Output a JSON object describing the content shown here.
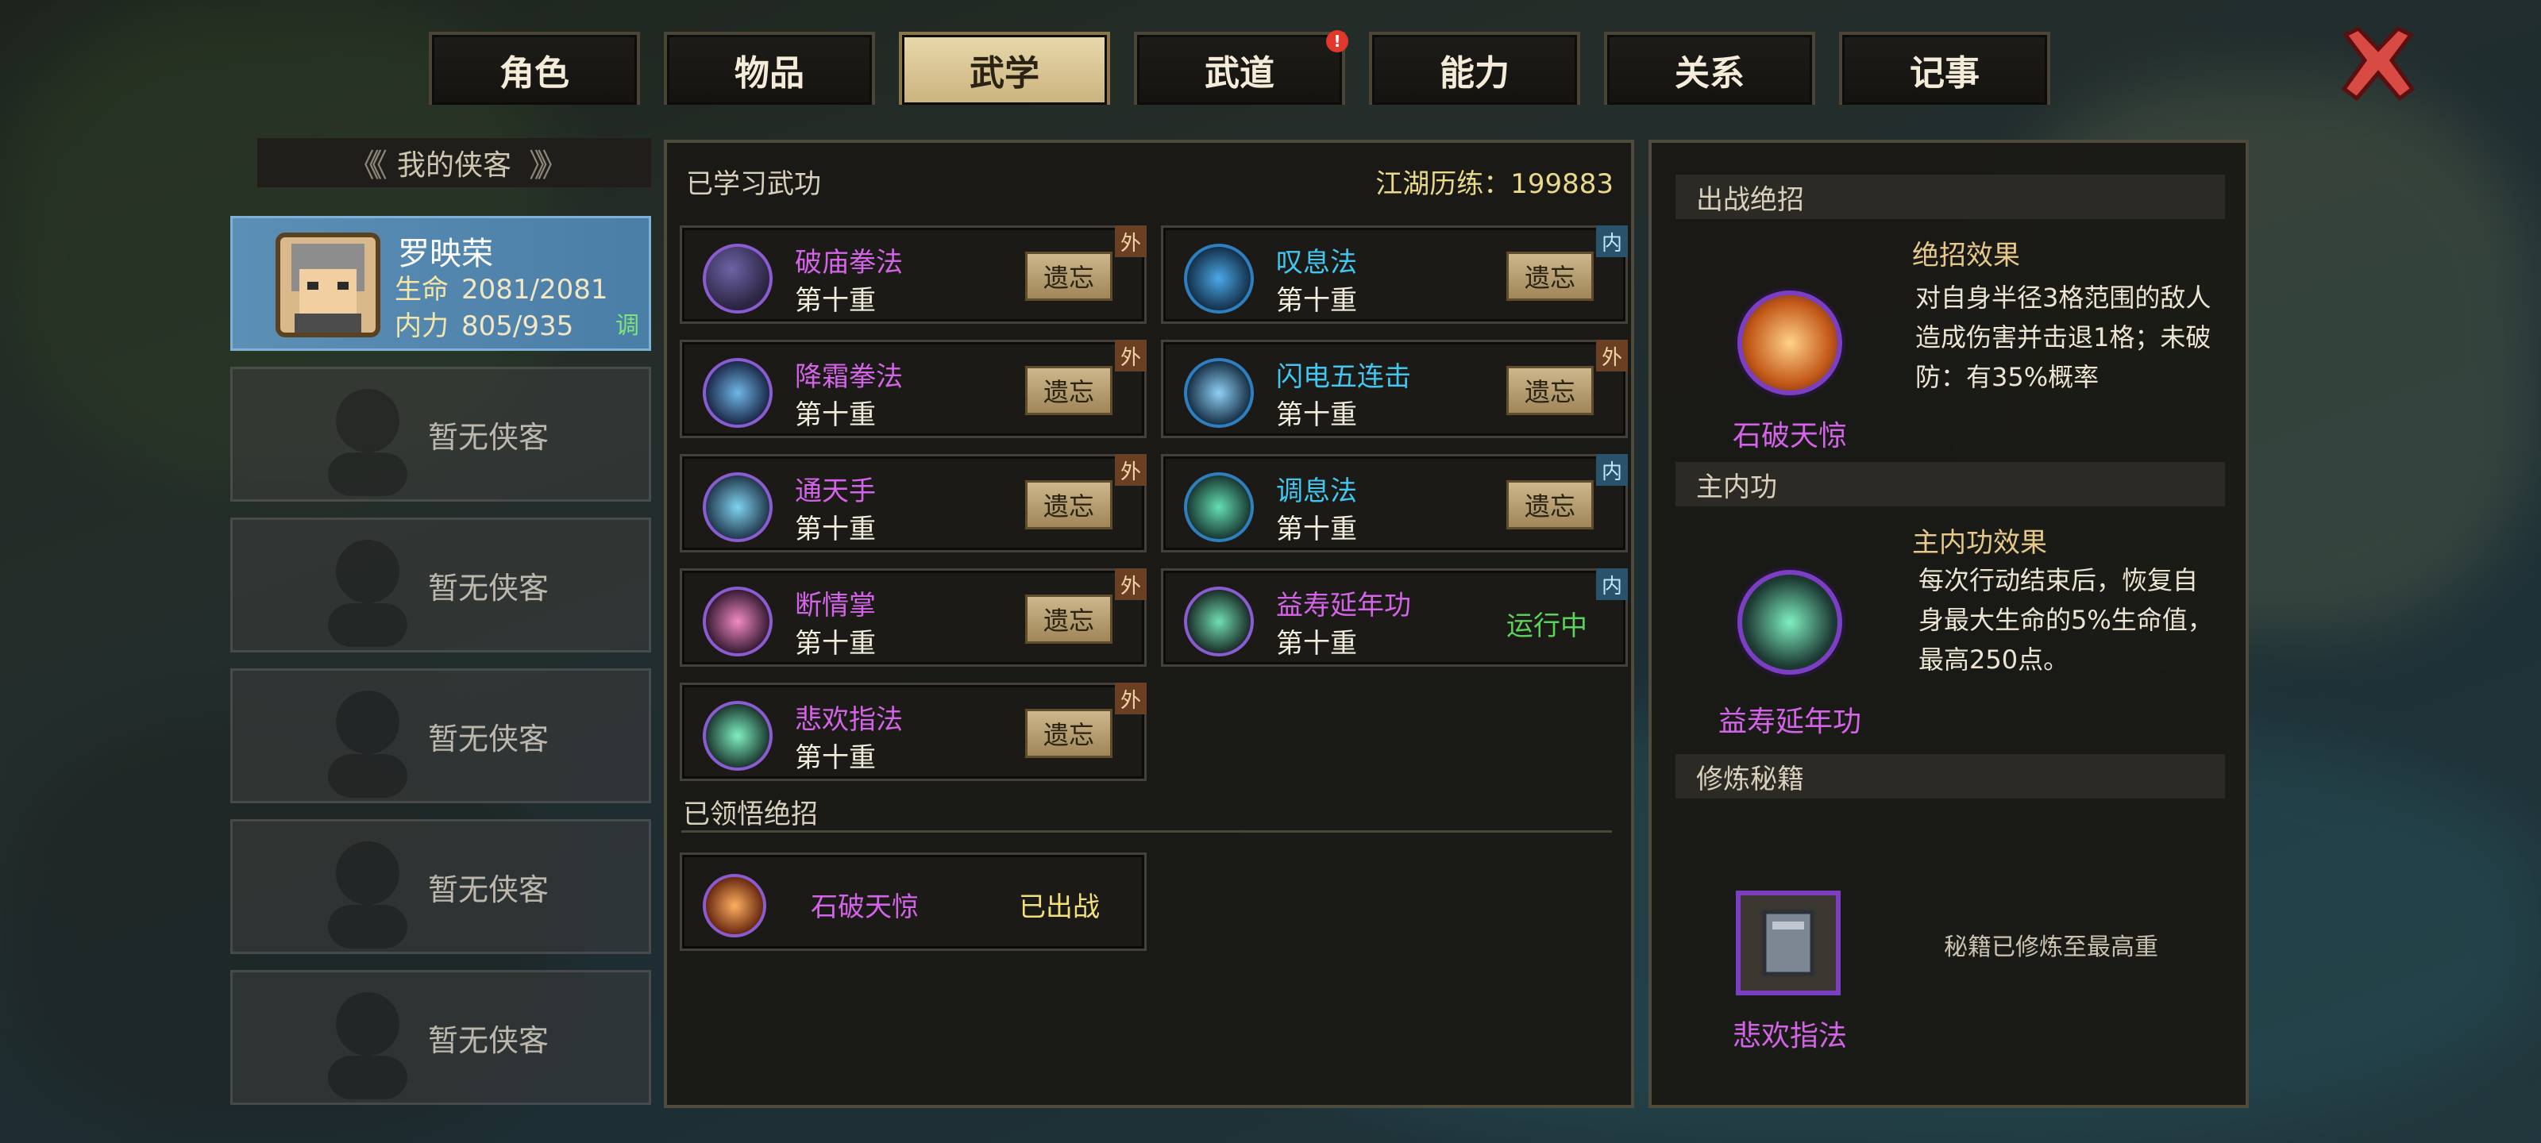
{
  "tabs": [
    {
      "label": "角色",
      "active": false,
      "badge": ""
    },
    {
      "label": "物品",
      "active": false,
      "badge": ""
    },
    {
      "label": "武学",
      "active": true,
      "badge": ""
    },
    {
      "label": "武道",
      "active": false,
      "badge": "!"
    },
    {
      "label": "能力",
      "active": false,
      "badge": ""
    },
    {
      "label": "关系",
      "active": false,
      "badge": ""
    },
    {
      "label": "记事",
      "active": false,
      "badge": ""
    }
  ],
  "close_icon": "close-x-icon",
  "sidebar": {
    "header": "我的侠客",
    "active_hero": {
      "name": "罗映荣",
      "hp_label": "生命",
      "hp_value": "2081/2081",
      "mp_label": "内力",
      "mp_value": "805/935",
      "adjust": "调"
    },
    "empty_slots": [
      "暂无侠客",
      "暂无侠客",
      "暂无侠客",
      "暂无侠客",
      "暂无侠客"
    ]
  },
  "learned": {
    "title": "已学习武功",
    "experience": "江湖历练：199883",
    "skills": [
      {
        "name": "破庙拳法",
        "level": "第十重",
        "action": "遗忘",
        "type": "外",
        "color": "purple"
      },
      {
        "name": "叹息法",
        "level": "第十重",
        "action": "遗忘",
        "type": "内",
        "color": "blue"
      },
      {
        "name": "降霜拳法",
        "level": "第十重",
        "action": "遗忘",
        "type": "外",
        "color": "purple"
      },
      {
        "name": "闪电五连击",
        "level": "第十重",
        "action": "遗忘",
        "type": "外",
        "color": "blue"
      },
      {
        "name": "通天手",
        "level": "第十重",
        "action": "遗忘",
        "type": "外",
        "color": "purple"
      },
      {
        "name": "调息法",
        "level": "第十重",
        "action": "遗忘",
        "type": "内",
        "color": "blue"
      },
      {
        "name": "断情掌",
        "level": "第十重",
        "action": "遗忘",
        "type": "外",
        "color": "purple"
      },
      {
        "name": "益寿延年功",
        "level": "第十重",
        "action": "运行中",
        "type": "内",
        "color": "purple"
      },
      {
        "name": "悲欢指法",
        "level": "第十重",
        "action": "遗忘",
        "type": "外",
        "color": "purple"
      }
    ]
  },
  "ultimate": {
    "title": "已领悟绝招",
    "name": "石破天惊",
    "status": "已出战"
  },
  "right": {
    "battle_title": "出战绝招",
    "battle_skill": "石破天惊",
    "battle_effect_title": "绝招效果",
    "battle_effect_text": "对自身半径3格范围的敌人造成伤害并击退1格；未破防：有35%概率",
    "main_title": "主内功",
    "main_skill": "益寿延年功",
    "main_effect_title": "主内功效果",
    "main_effect_text": "每次行动结束后，恢复自身最大生命的5%生命值，最高250点。",
    "book_title": "修炼秘籍",
    "book_name": "悲欢指法",
    "book_note": "秘籍已修炼至最高重"
  },
  "colors": {
    "purple": "#d364e8",
    "blue": "#41c6f0",
    "running": "#5bd35a",
    "accent_tab": "#e9d9ac"
  }
}
